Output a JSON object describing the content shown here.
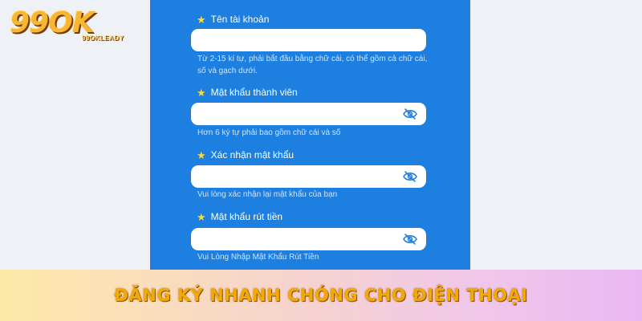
{
  "logo": {
    "text": "99OK",
    "subtext": "99OKLEADY"
  },
  "form": {
    "fields": [
      {
        "label": "Tên tài khoản",
        "hint": "Từ 2-15 kí tự, phải bắt đầu bằng chữ cái, có thể gồm cả chữ cái, số và gạch dưới.",
        "value": ""
      },
      {
        "label": "Mật khẩu thành viên",
        "hint": "Hơn 6 ký tự phải bao gồm chữ cái và số",
        "value": ""
      },
      {
        "label": "Xác nhận mật khẩu",
        "hint": "Vui lòng xác nhận lại mật khẩu của bạn",
        "value": ""
      },
      {
        "label": "Mật khẩu rút tiền",
        "hint": "Vui Lòng Nhập Mật Khẩu Rút Tiền",
        "value": ""
      }
    ]
  },
  "banner": {
    "text": "ĐĂNG KÝ NHANH CHÓNG CHO ĐIỆN THOẠI"
  },
  "icons": {
    "required": "star-icon",
    "visibility": "eye-slash-icon"
  },
  "colors": {
    "panel": "#1d7fe0",
    "star": "#ffd83b",
    "eye": "#1d7fe0",
    "banner_text": "#f2a900"
  }
}
